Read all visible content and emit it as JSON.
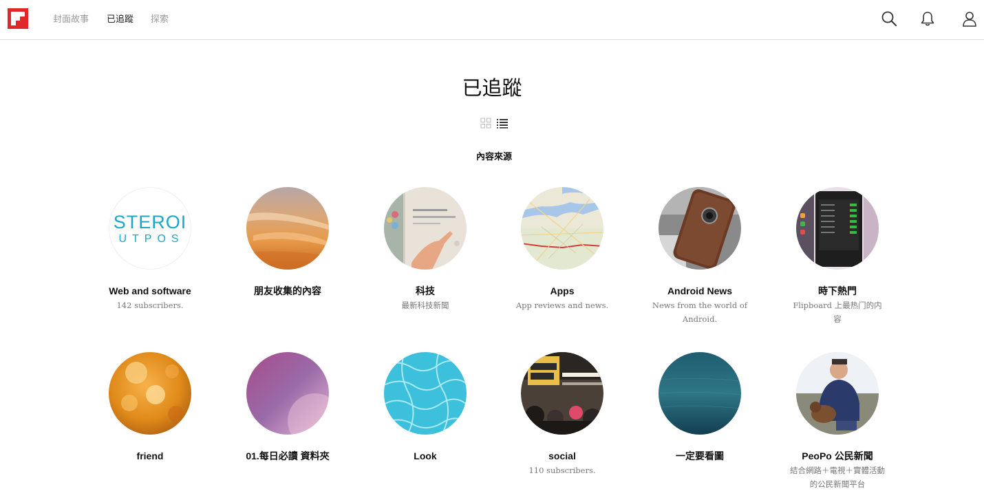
{
  "nav": {
    "links": [
      "封面故事",
      "已追蹤",
      "探索"
    ]
  },
  "header": {
    "title": "已追蹤",
    "section_label": "內容來源"
  },
  "colors": {
    "brand": "#e12828",
    "nav_inactive": "#999999",
    "text_dark": "#111111",
    "text_muted": "#777777"
  },
  "icons": {
    "right": [
      "search-icon",
      "bell-icon",
      "user-icon"
    ],
    "view_toggle": [
      "grid-view-icon",
      "list-view-icon"
    ]
  },
  "sources": [
    {
      "name": "Web and software",
      "desc": "142 subscribers.",
      "avatar_text_1": "STEROI",
      "avatar_text_2": "UTPOS"
    },
    {
      "name": "朋友收集的內容",
      "desc": ""
    },
    {
      "name": "科技",
      "desc": "最新科技新聞"
    },
    {
      "name": "Apps",
      "desc": "App reviews and news."
    },
    {
      "name": "Android News",
      "desc": "News from the world of Android."
    },
    {
      "name": "時下熱門",
      "desc": "Flipboard 上最热门的内容"
    },
    {
      "name": "friend",
      "desc": ""
    },
    {
      "name": "01.每日必讀 資料夾",
      "desc": ""
    },
    {
      "name": "Look",
      "desc": ""
    },
    {
      "name": "social",
      "desc": "110 subscribers."
    },
    {
      "name": "一定要看圖",
      "desc": ""
    },
    {
      "name": "PeoPo 公民新聞",
      "desc": "結合網路＋電視＋實體活動的公民新聞平台"
    }
  ]
}
